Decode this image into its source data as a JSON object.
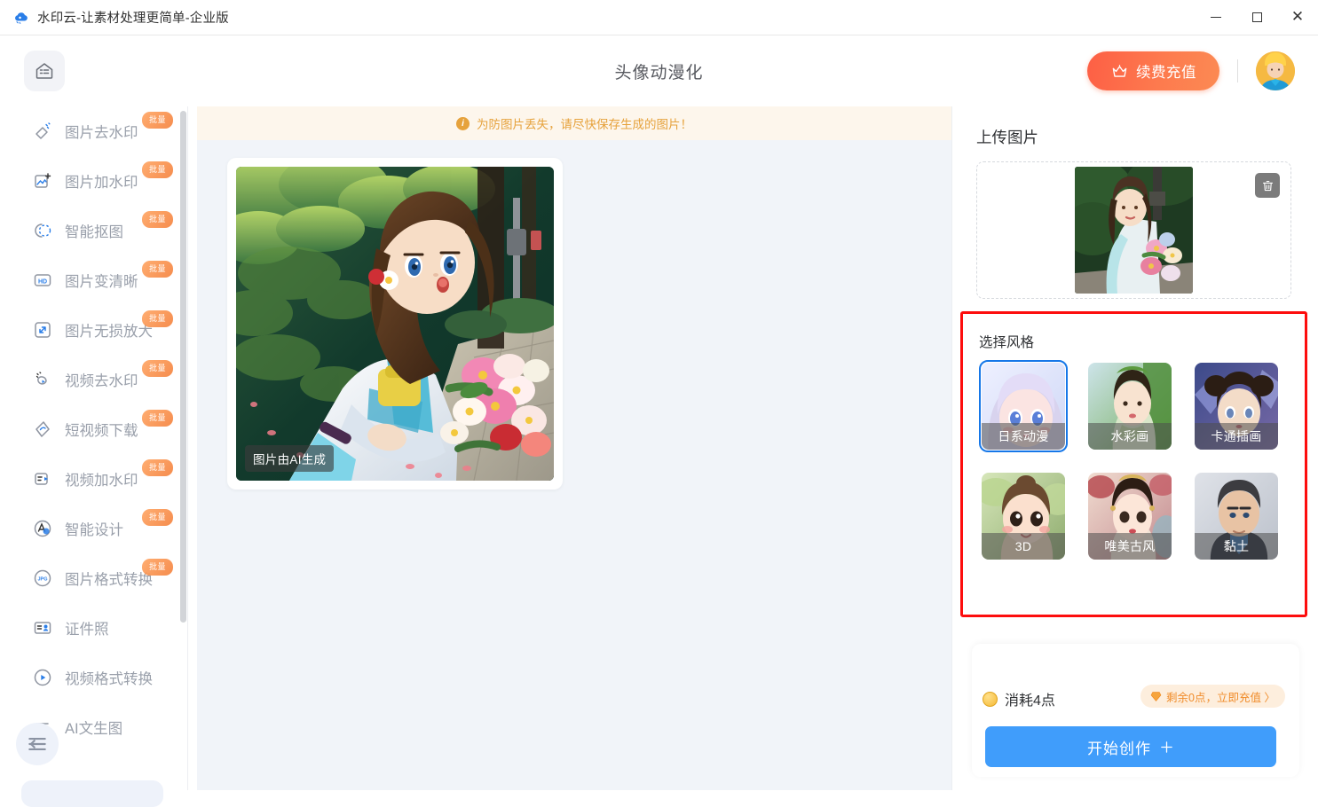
{
  "window": {
    "title": "水印云-让素材处理更简单-企业版",
    "logo_icon": "cloud-logo-icon",
    "controls": {
      "minimize": "minimize-icon",
      "maximize": "maximize-icon",
      "close": "close-icon"
    }
  },
  "header": {
    "home_icon": "home-icon",
    "page_title": "头像动漫化",
    "recharge_label": "续费充值",
    "recharge_icon": "crown-icon",
    "avatar_icon": "user-avatar"
  },
  "sidebar": {
    "badge_label": "批量",
    "collapse_icon": "collapse-sidebar-icon",
    "items": [
      {
        "label": "图片去水印",
        "icon": "eraser-icon",
        "badge": true
      },
      {
        "label": "图片加水印",
        "icon": "image-watermark-icon",
        "badge": true
      },
      {
        "label": "智能抠图",
        "icon": "cutout-icon",
        "badge": true
      },
      {
        "label": "图片变清晰",
        "icon": "hd-icon",
        "badge": true
      },
      {
        "label": "图片无损放大",
        "icon": "enlarge-icon",
        "badge": true
      },
      {
        "label": "视频去水印",
        "icon": "video-eraser-icon",
        "badge": true
      },
      {
        "label": "短视频下载",
        "icon": "download-video-icon",
        "badge": true
      },
      {
        "label": "视频加水印",
        "icon": "video-watermark-icon",
        "badge": true
      },
      {
        "label": "智能设计",
        "icon": "design-icon",
        "badge": true
      },
      {
        "label": "图片格式转换",
        "icon": "jpg-icon",
        "badge": true
      },
      {
        "label": "证件照",
        "icon": "id-photo-icon",
        "badge": false
      },
      {
        "label": "视频格式转换",
        "icon": "video-convert-icon",
        "badge": false
      },
      {
        "label": "AI文生图",
        "icon": "ai-text-to-image-icon",
        "badge": false
      }
    ]
  },
  "main": {
    "warning_text": "为防图片丢失，请尽快保存生成的图片！",
    "warning_icon": "info-icon",
    "result_ai_tag": "图片由AI生成"
  },
  "right_panel": {
    "upload_title": "上传图片",
    "delete_icon": "trash-icon",
    "style_title": "选择风格",
    "styles": [
      {
        "name": "日系动漫",
        "selected": true
      },
      {
        "name": "水彩画",
        "selected": false
      },
      {
        "name": "卡通插画",
        "selected": false
      },
      {
        "name": "3D",
        "selected": false
      },
      {
        "name": "唯美古风",
        "selected": false
      },
      {
        "name": "黏土",
        "selected": false
      }
    ],
    "cost_label": "消耗4点",
    "cost_icon": "coin-icon",
    "remain_label": "剩余0点，立即充值 〉",
    "remain_icon": "diamond-icon",
    "create_label": "开始创作",
    "create_icon": "sparkle-icon"
  },
  "colors": {
    "accent_orange": "#fd6e46",
    "accent_blue": "#409dfb",
    "selected_border": "#1677e8",
    "highlight_red": "#fd0d0d",
    "warning": "#e6a23c",
    "bg": "#f1f4f9"
  }
}
